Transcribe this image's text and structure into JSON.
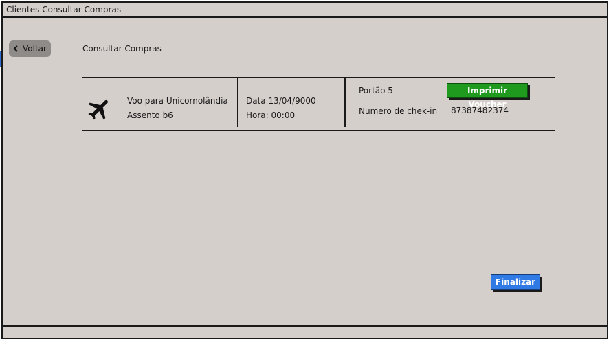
{
  "window": {
    "title": "Clientes Consultar Compras"
  },
  "nav": {
    "back_label": "Voltar",
    "back_icon": "chevron-left-icon"
  },
  "page": {
    "title": "Consultar Compras"
  },
  "purchase": {
    "icon": "airplane-icon",
    "flight": "Voo para Unicornolândia",
    "seat": "Assento b6",
    "date": "Data 13/04/9000",
    "time": "Hora: 00:00",
    "gate": "Portão 5",
    "checkin_label": "Numero de chek-in",
    "checkin_number": "87387482374",
    "print_button": "Imprimir Voucher"
  },
  "actions": {
    "finish_button": "Finalizar"
  },
  "colors": {
    "print_button": "#1f9a1f",
    "finish_button": "#2f7ae5",
    "background": "#d5cfcc"
  }
}
